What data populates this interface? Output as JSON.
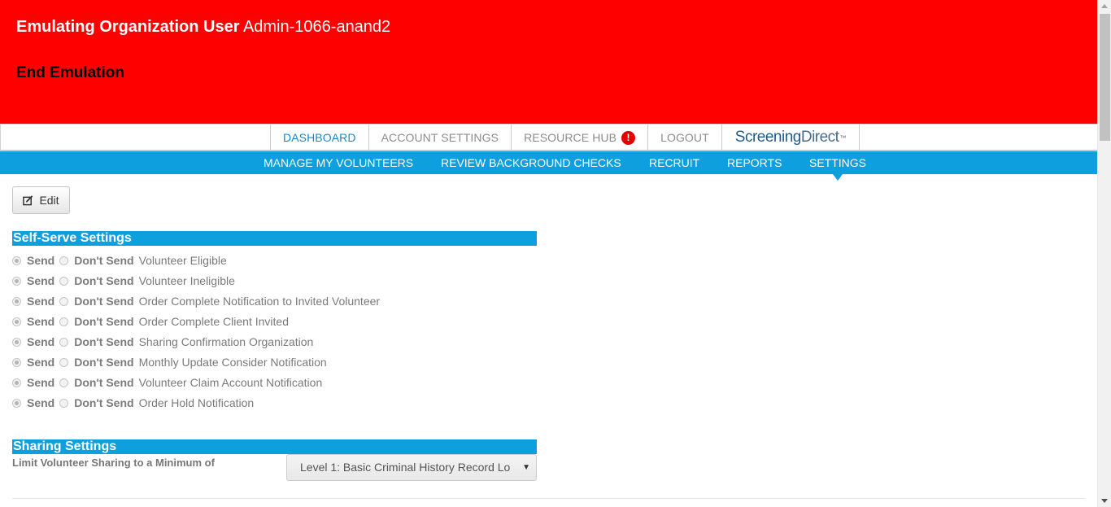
{
  "banner": {
    "title_prefix": "Emulating Organization User",
    "user": "Admin-1066-anand2",
    "end_label": "End Emulation"
  },
  "topnav": {
    "items": [
      {
        "label": "DASHBOARD",
        "active": true
      },
      {
        "label": "ACCOUNT SETTINGS",
        "active": false
      },
      {
        "label": "RESOURCE HUB",
        "active": false,
        "badge": "!"
      },
      {
        "label": "LOGOUT",
        "active": false
      }
    ],
    "brand": {
      "part1": "Screening",
      "part2": "Direct",
      "tm": "™"
    }
  },
  "subnav": {
    "items": [
      {
        "label": "MANAGE MY VOLUNTEERS"
      },
      {
        "label": "REVIEW BACKGROUND CHECKS"
      },
      {
        "label": "RECRUIT"
      },
      {
        "label": "REPORTS"
      },
      {
        "label": "SETTINGS",
        "active": true
      }
    ]
  },
  "edit": {
    "label": "Edit",
    "icon": "edit-icon"
  },
  "self_serve": {
    "title": "Self-Serve Settings",
    "send_label": "Send",
    "dont_send_label": "Don't Send",
    "rows": [
      {
        "label": "Volunteer Eligible",
        "selected": "send"
      },
      {
        "label": "Volunteer Ineligible",
        "selected": "send"
      },
      {
        "label": "Order Complete Notification to Invited Volunteer",
        "selected": "send"
      },
      {
        "label": "Order Complete Client Invited",
        "selected": "send"
      },
      {
        "label": "Sharing Confirmation Organization",
        "selected": "send"
      },
      {
        "label": "Monthly Update Consider Notification",
        "selected": "send"
      },
      {
        "label": "Volunteer Claim Account Notification",
        "selected": "send"
      },
      {
        "label": "Order Hold Notification",
        "selected": "send"
      }
    ]
  },
  "sharing": {
    "title": "Sharing Settings",
    "limit_label": "Limit Volunteer Sharing to a Minimum of",
    "selected_value": "Level 1: Basic Criminal History Record Lo"
  },
  "colors": {
    "banner": "#ff0000",
    "accent": "#0ea0de",
    "active_link": "#1a87c9"
  }
}
